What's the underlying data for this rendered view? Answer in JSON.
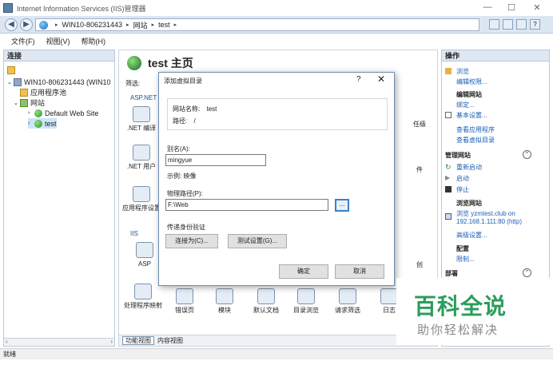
{
  "window": {
    "title": "Internet Information Services (IIS)管理器",
    "min": "—",
    "max": "☐",
    "close": "✕"
  },
  "address": {
    "crumbs": [
      "WIN10-806231443",
      "网站",
      "test"
    ],
    "arrow": "▸"
  },
  "menu": {
    "file": "文件(F)",
    "view": "视图(V)",
    "help": "帮助(H)"
  },
  "connections": {
    "header": "连接",
    "tree": [
      {
        "label": "WIN10-806231443 (WIN10"
      },
      {
        "label": "应用程序池"
      },
      {
        "label": "网站"
      },
      {
        "label": "Default Web Site"
      },
      {
        "label": "test"
      }
    ]
  },
  "center": {
    "title": "test 主页",
    "filter_label": "筛选:",
    "group_aspnet": "ASP.NET",
    "group_iis": "IIS",
    "features": {
      "net_compile": ".NET 编译",
      "net_users": ".NET 用户",
      "app_settings": "应用程序设置",
      "asp": "ASP",
      "handler_mappings": "处理程序映射",
      "error_pages": "错误页",
      "modules": "模块",
      "default_doc": "默认文档",
      "dir_browse": "目录浏览",
      "request_filter": "请求筛选",
      "log": "日志",
      "trust_level": "任级",
      "file_part": "件",
      "create_part": "创"
    },
    "view_tabs": {
      "feature_view": "功能视图",
      "content_view": "内容视图"
    }
  },
  "actions": {
    "header": "操作",
    "browse": "浏览",
    "edit_perms": "编辑权限...",
    "edit_site_title": "编辑网站",
    "bindings": "绑定...",
    "basic_settings": "基本设置...",
    "view_apps": "查看应用程序",
    "view_vdirs": "查看虚拟目录",
    "manage_site": "管理网站",
    "restart": "重新启动",
    "start": "启动",
    "stop": "停止",
    "browse_site": "浏览网站",
    "browse_link1": "浏览 yzmtest.club on",
    "browse_link2": "192.168.1.111:80 (http)",
    "advanced": "高级设置...",
    "config": "配置",
    "limits": "限制...",
    "deploy": "部署"
  },
  "status": {
    "text": "就绪"
  },
  "dialog": {
    "title": "添加虚拟目录",
    "help": "?",
    "close": "✕",
    "site_name_label": "网站名称:",
    "site_name_value": "test",
    "path_label": "路径:",
    "path_value": "/",
    "alias_label": "别名(A):",
    "alias_value": "mingyue",
    "example": "示例: 映像",
    "physical_label": "物理路径(P):",
    "physical_value": "F:\\Web",
    "browse_btn": "...",
    "auth_label": "传递身份验证",
    "connect_as": "连接为(C)...",
    "test_settings": "测试设置(G)...",
    "ok": "确定",
    "cancel": "取消"
  },
  "watermark": {
    "big": "百科全说",
    "small": "助你轻松解决"
  }
}
